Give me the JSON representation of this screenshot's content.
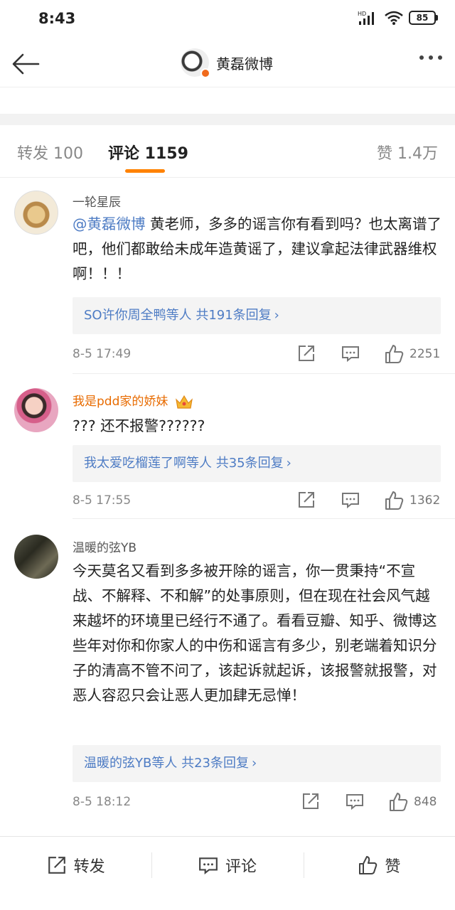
{
  "status_bar": {
    "time": "8:43",
    "network": "HD",
    "battery": "85"
  },
  "header": {
    "title": "黄磊微博"
  },
  "tabs": [
    {
      "label": "转发 100"
    },
    {
      "label": "评论 1159"
    },
    {
      "label": "赞 1.4万"
    }
  ],
  "comments": [
    {
      "username": "一轮星辰",
      "mention": "@黄磊微博",
      "text": " 黄老师，多多的谣言你有看到吗？也太离谱了吧，他们都敢给未成年造黄谣了，建议拿起法律武器维权啊！！！",
      "reply_summary": "SO许你周全鸭等人 共191条回复",
      "timestamp": "8-5 17:49",
      "likes": "2251"
    },
    {
      "username": "我是pdd家的娇妹",
      "text": "??? 还不报警??????",
      "reply_summary": "我太爱吃榴莲了啊等人 共35条回复",
      "timestamp": "8-5 17:55",
      "likes": "1362"
    },
    {
      "username": "温暖的弦YB",
      "text": "今天莫名又看到多多被开除的谣言，你一贯秉持“不宣战、不解释、不和解”的处事原则，但在现在社会风气越来越坏的环境里已经行不通了。看看豆瓣、知乎、微博这些年对你和你家人的中伤和谣言有多少，别老端着知识分子的清高不管不问了，该起诉就起诉，该报警就报警，对恶人容忍只会让恶人更加肆无忌惮！",
      "reply_summary": "温暖的弦YB等人 共23条回复",
      "timestamp": "8-5 18:12",
      "likes": "848"
    }
  ],
  "bottom_bar": {
    "repost": "转发",
    "comment": "评论",
    "like": "赞"
  },
  "colors": {
    "accent": "#ff8200",
    "link": "#4e7cc4",
    "vip_name": "#e86b00"
  }
}
